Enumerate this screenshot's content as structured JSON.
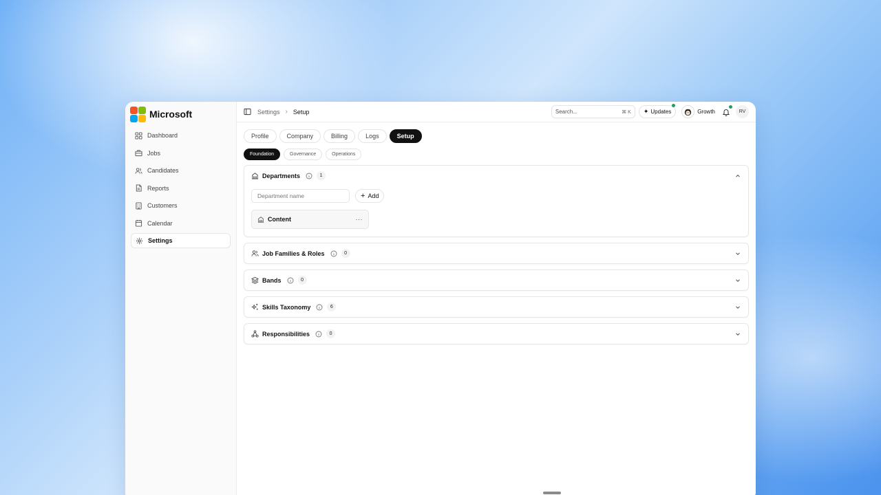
{
  "brand": {
    "name": "Microsoft",
    "logo_colors": [
      "#f35325",
      "#81bc06",
      "#05a6f0",
      "#ffba08"
    ]
  },
  "sidebar": {
    "items": [
      {
        "label": "Dashboard",
        "icon": "dashboard-icon"
      },
      {
        "label": "Jobs",
        "icon": "briefcase-icon"
      },
      {
        "label": "Candidates",
        "icon": "users-icon"
      },
      {
        "label": "Reports",
        "icon": "file-icon"
      },
      {
        "label": "Customers",
        "icon": "building-icon"
      },
      {
        "label": "Calendar",
        "icon": "calendar-icon"
      },
      {
        "label": "Settings",
        "icon": "gear-icon",
        "active": true
      }
    ]
  },
  "topbar": {
    "breadcrumb": [
      "Settings",
      "Setup"
    ],
    "search": {
      "placeholder": "Search...",
      "shortcut": "⌘ K"
    },
    "updates_label": "Updates",
    "workspace_label": "Growth",
    "user_initials": "RV",
    "status_color": "#22a05a"
  },
  "tabs": [
    "Profile",
    "Company",
    "Billing",
    "Logs",
    "Setup"
  ],
  "active_tab": "Setup",
  "subtabs": [
    "Foundation",
    "Governance",
    "Operations"
  ],
  "active_subtab": "Foundation",
  "sections": [
    {
      "title": "Departments",
      "count": "1",
      "icon": "building-icon",
      "expanded": true,
      "input_placeholder": "Department name",
      "add_label": "Add",
      "items": [
        {
          "name": "Content",
          "more": "···"
        }
      ]
    },
    {
      "title": "Job Families & Roles",
      "count": "0",
      "icon": "users-icon",
      "expanded": false
    },
    {
      "title": "Bands",
      "count": "0",
      "icon": "layers-icon",
      "expanded": false
    },
    {
      "title": "Skills Taxonomy",
      "count": "6",
      "icon": "sparkles-icon",
      "expanded": false
    },
    {
      "title": "Responsibilities",
      "count": "0",
      "icon": "network-icon",
      "expanded": false
    }
  ]
}
